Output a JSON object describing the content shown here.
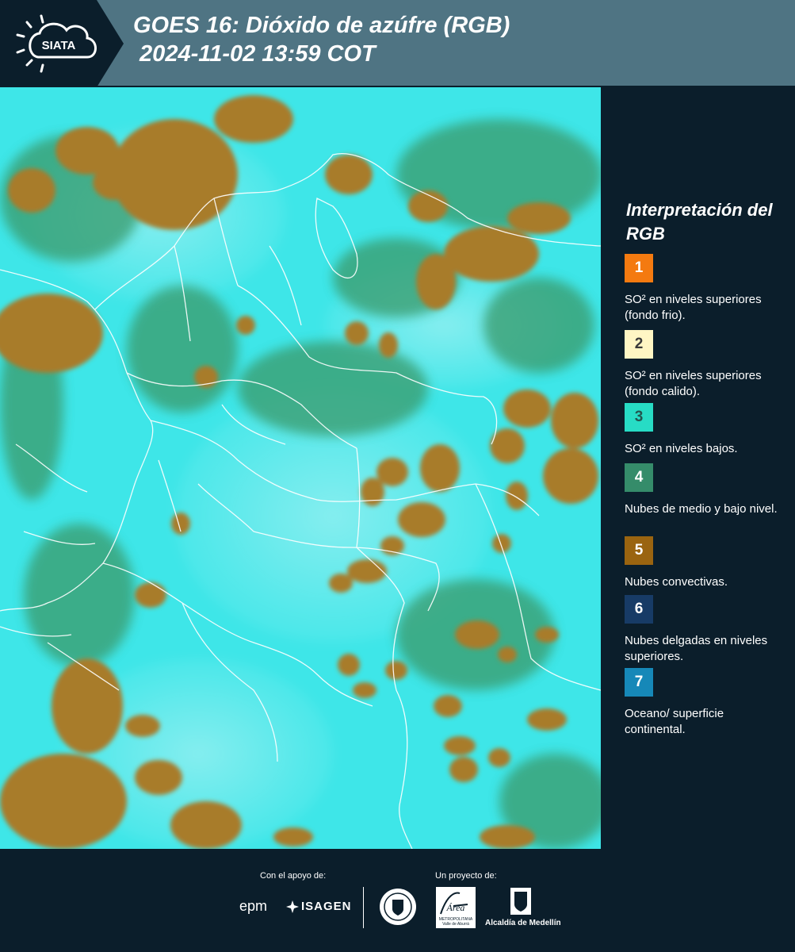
{
  "header": {
    "logo_text": "SIATA",
    "title": "GOES 16: Dióxido de azúfre (RGB)\n 2024-11-02 13:59 COT"
  },
  "map": {
    "background_color": "#3ee6e8",
    "cloud_color": "#a87b2c",
    "vegetation_color": "#3a9a6a",
    "border_color": "#ffffff"
  },
  "legend": {
    "title": "Interpretación del RGB",
    "items": [
      {
        "number": "1",
        "color": "#f47a10",
        "text": "SO² en niveles superiores (fondo frio)."
      },
      {
        "number": "2",
        "color": "#fff6c4",
        "text": "SO² en niveles superiores (fondo calido)."
      },
      {
        "number": "3",
        "color": "#27dcc5",
        "text": "SO² en niveles bajos."
      },
      {
        "number": "4",
        "color": "#358c6a",
        "text": "Nubes de medio y bajo nivel."
      },
      {
        "number": "5",
        "color": "#9a6410",
        "text": "Nubes convectivas."
      },
      {
        "number": "6",
        "color": "#173b66",
        "text": "Nubes delgadas en niveles superiores."
      },
      {
        "number": "7",
        "color": "#1688b8",
        "text": "Oceano/ superficie continental."
      }
    ]
  },
  "footer": {
    "support_label": "Con el apoyo de:",
    "project_label": "Un proyecto de:",
    "epm": "epm",
    "isagen": "ISAGEN",
    "area_line1": "METROPOLITANA",
    "area_line2": "Valle de Aburrá",
    "area_title": "Área",
    "alcaldia": "Alcaldía de Medellín"
  }
}
